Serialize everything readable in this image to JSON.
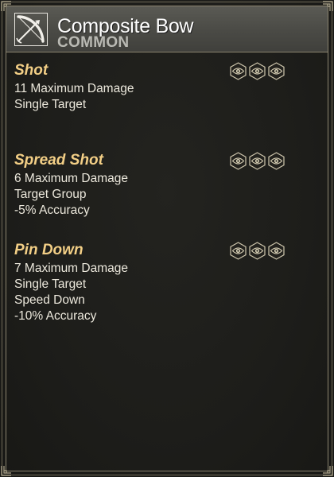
{
  "item": {
    "name": "Composite Bow",
    "rarity": "COMMON",
    "icon": "bow-icon"
  },
  "skills": [
    {
      "name": "Shot",
      "lines": [
        "11 Maximum Damage",
        "Single Target"
      ],
      "slot_icons": [
        "eye-icon",
        "eye-icon",
        "eye-icon"
      ]
    },
    {
      "name": "Spread Shot",
      "lines": [
        "6 Maximum Damage",
        "Target Group",
        "-5% Accuracy"
      ],
      "slot_icons": [
        "eye-icon",
        "eye-icon",
        "eye-icon"
      ]
    },
    {
      "name": "Pin Down",
      "lines": [
        "7 Maximum Damage",
        "Single Target",
        "Speed Down",
        "-10% Accuracy"
      ],
      "slot_icons": [
        "eye-icon",
        "eye-icon",
        "eye-icon"
      ]
    }
  ],
  "colors": {
    "skill_name": "#f3cf86",
    "body_text": "#ece8dc",
    "rarity": "#b9b9b3",
    "header_bg": "#4d4d48",
    "panel_bg": "#1d1d1a",
    "border": "#8a836e"
  }
}
